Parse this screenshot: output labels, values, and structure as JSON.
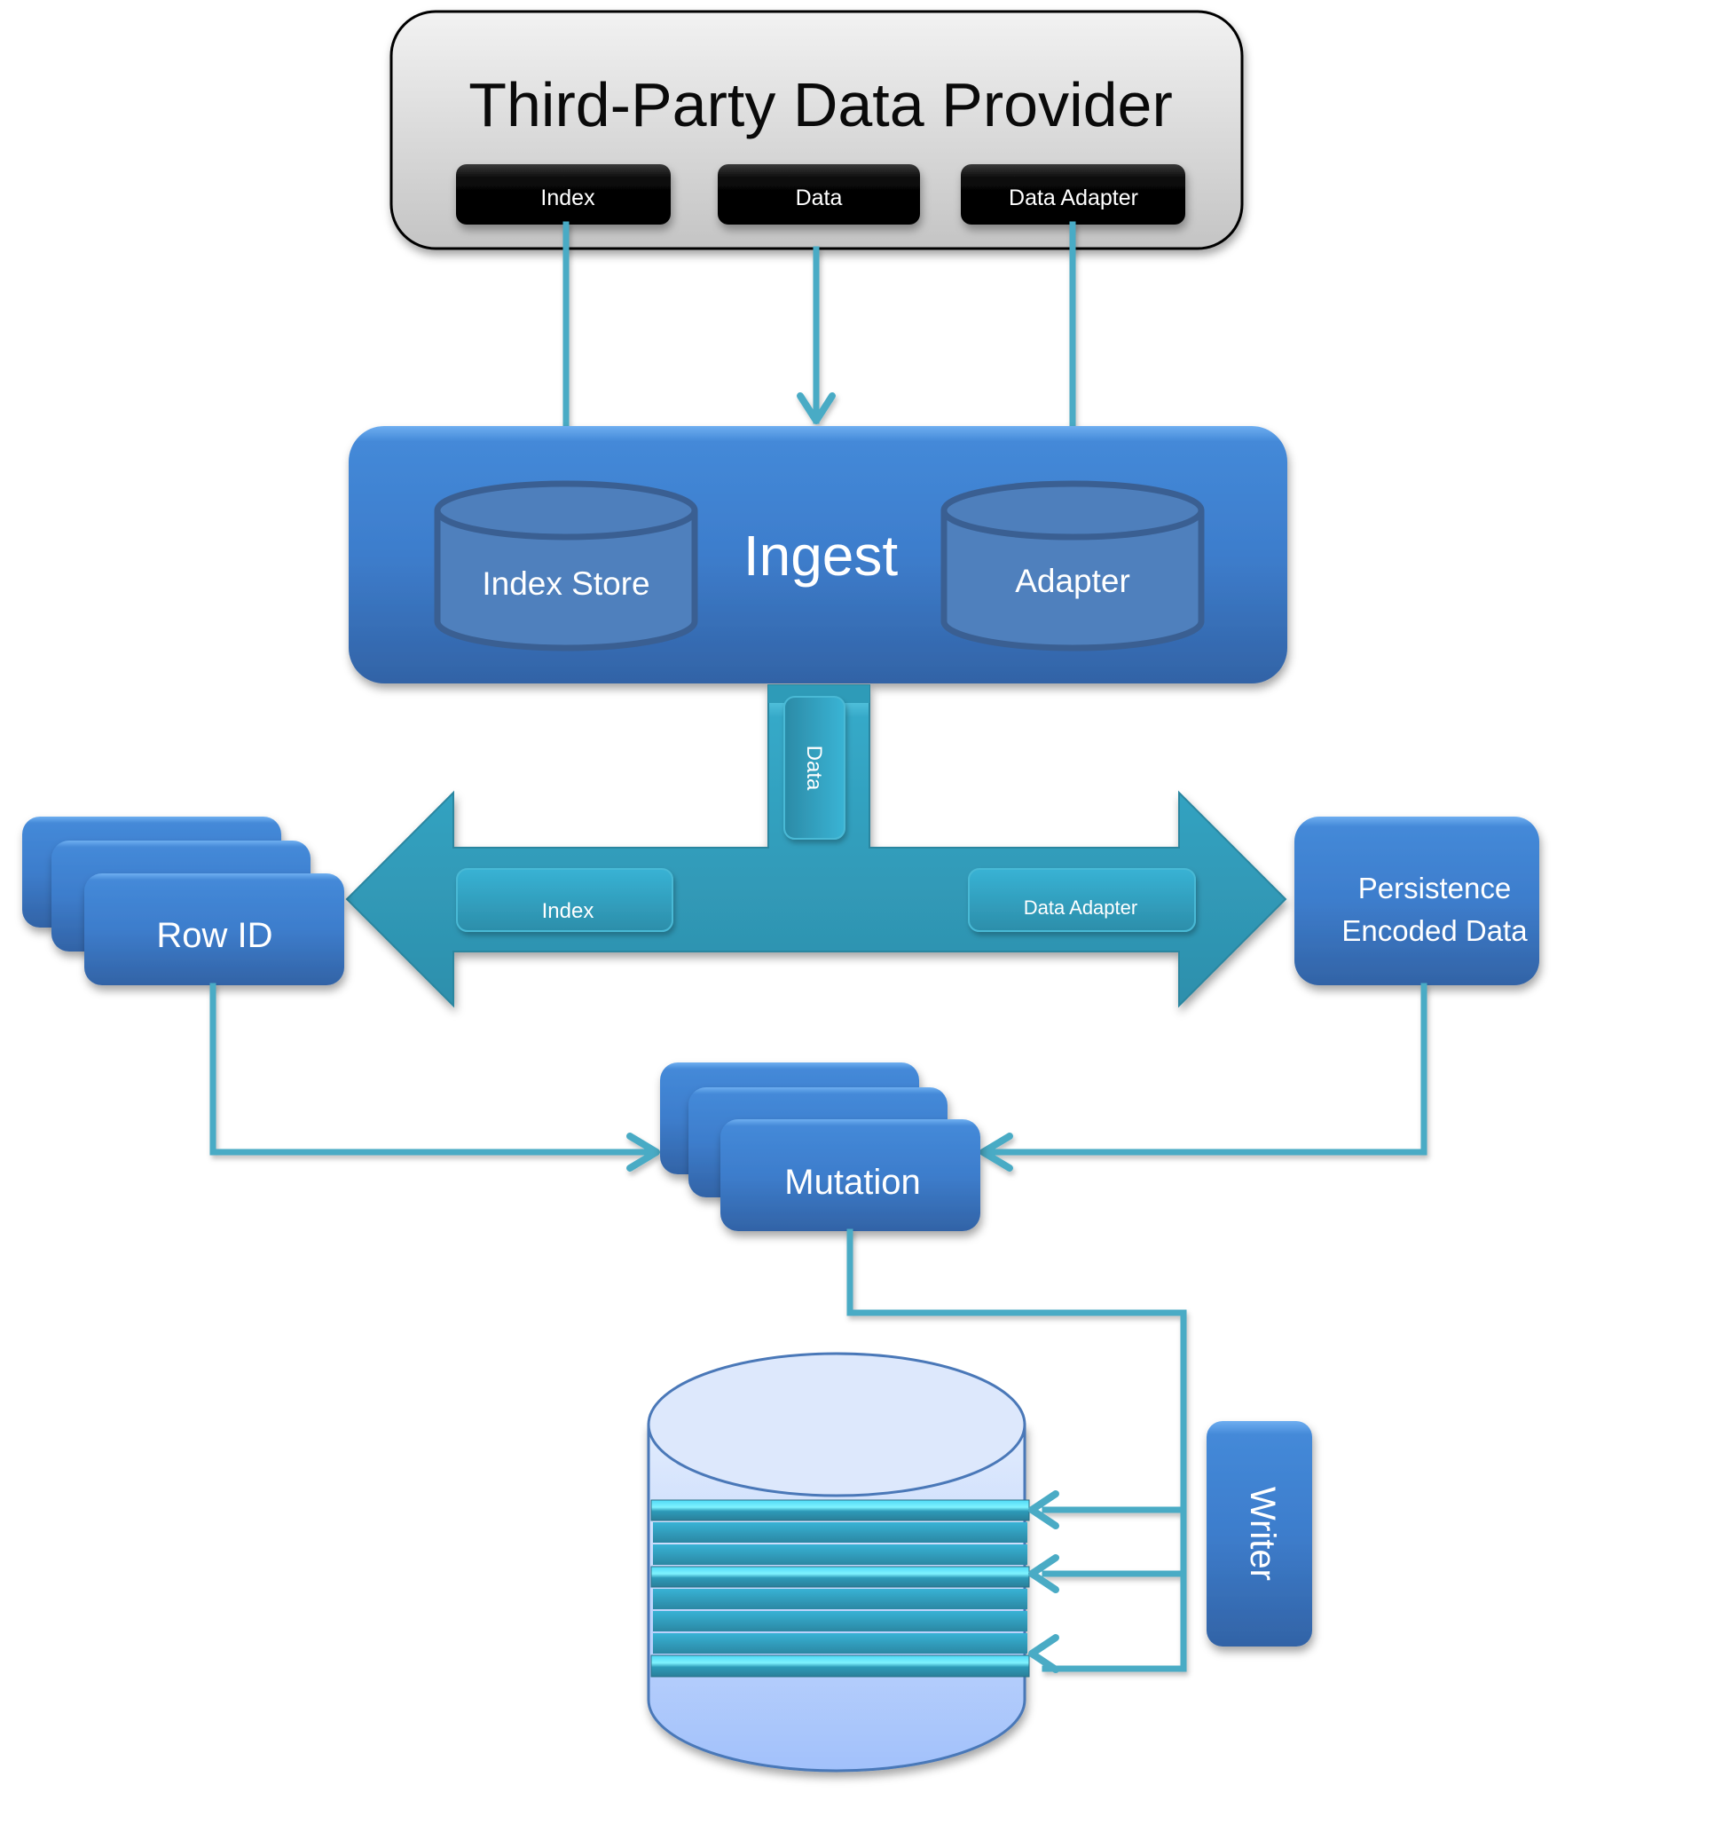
{
  "provider": {
    "title": "Third-Party Data Provider",
    "buttons": [
      {
        "label": "Index"
      },
      {
        "label": "Data"
      },
      {
        "label": "Data Adapter"
      }
    ]
  },
  "ingest": {
    "title": "Ingest",
    "stores": [
      {
        "label": "Index Store"
      },
      {
        "label": "Adapter"
      }
    ]
  },
  "flow_arrow": {
    "stem_label": "Data",
    "left_label": "Index",
    "right_label": "Data Adapter"
  },
  "row_id": {
    "label": "Row ID"
  },
  "persistence": {
    "line1": "Persistence",
    "line2": "Encoded Data"
  },
  "mutation": {
    "label": "Mutation"
  },
  "writer": {
    "label": "Writer"
  },
  "colors": {
    "box_blue": "#3f7fcf",
    "connector": "#4aabc5",
    "flow_teal": "#2e9bb8",
    "provider_bg": "#d8d8d8",
    "cylinder_fill": "#d6e4fb"
  }
}
